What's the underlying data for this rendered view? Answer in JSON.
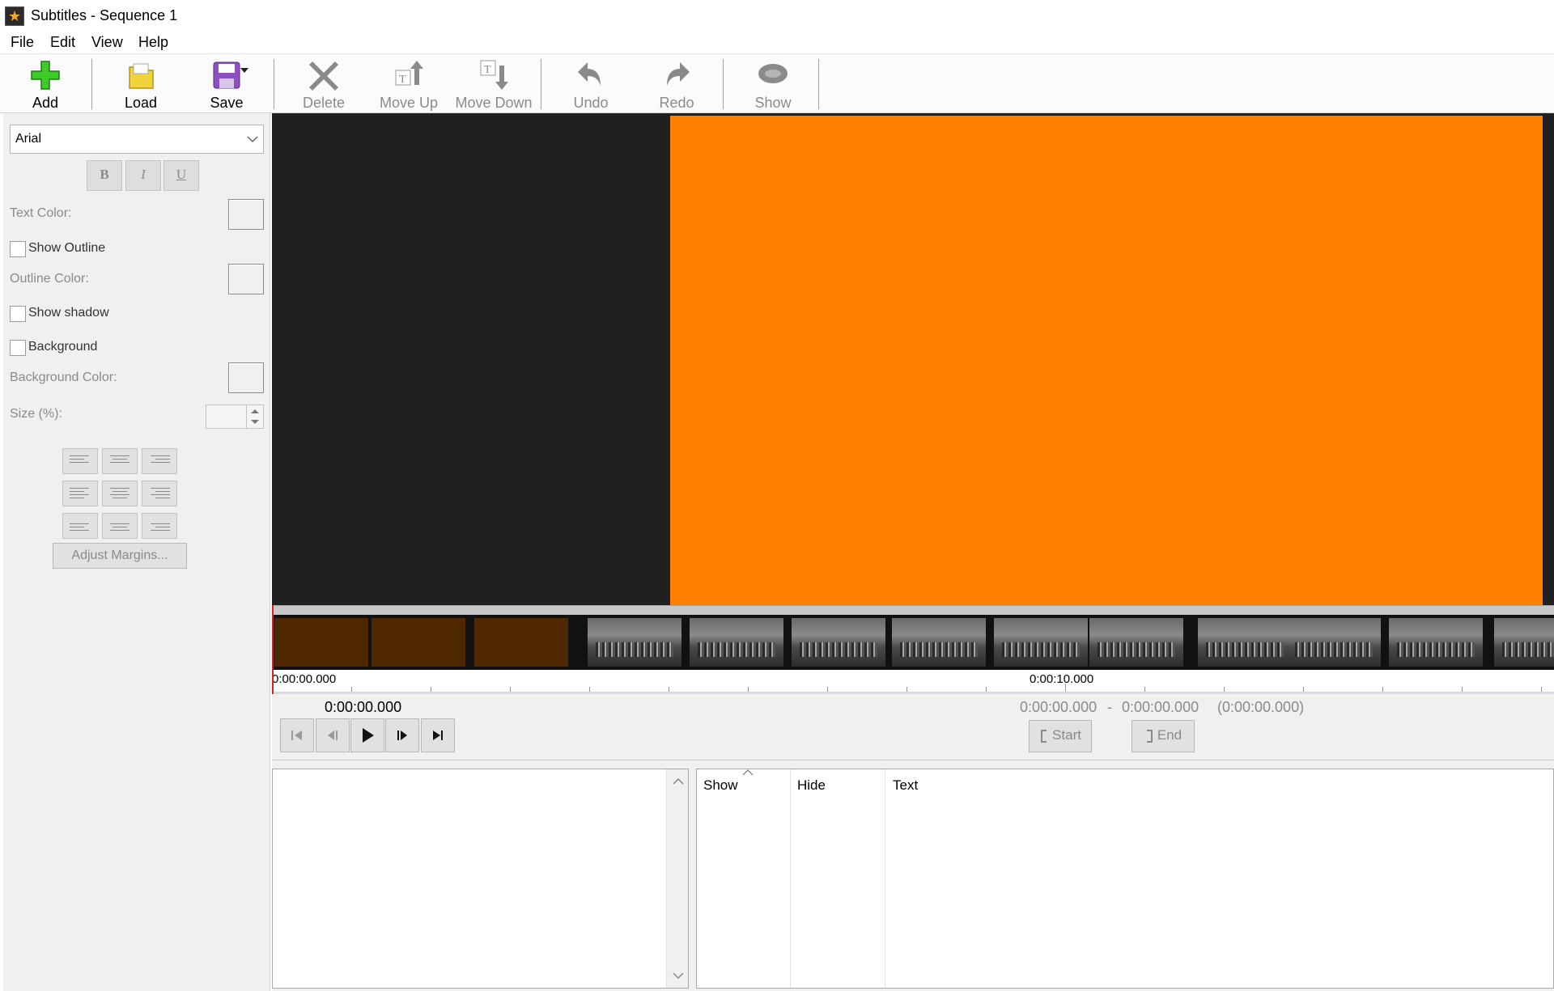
{
  "window": {
    "title": "Subtitles - Sequence 1",
    "icon": "clapperboard-star-icon"
  },
  "menu": [
    "File",
    "Edit",
    "View",
    "Help"
  ],
  "toolbar": {
    "add": "Add",
    "load": "Load",
    "save": "Save",
    "delete": "Delete",
    "move_up": "Move Up",
    "move_down": "Move Down",
    "undo": "Undo",
    "redo": "Redo",
    "show": "Show"
  },
  "style_panel": {
    "font": "Arial",
    "bold": "B",
    "italic": "I",
    "underline": "U",
    "text_color_label": "Text Color:",
    "show_outline": "Show Outline",
    "outline_color_label": "Outline Color:",
    "show_shadow": "Show shadow",
    "background": "Background",
    "background_color_label": "Background Color:",
    "size_label": "Size (%):",
    "size_value": "",
    "adjust_margins": "Adjust Margins..."
  },
  "preview": {
    "colors": {
      "background": "#202020",
      "frame": "#ff8000"
    }
  },
  "timeline": {
    "start_label": "0:00:00.000",
    "mid_label": "0:00:10.000"
  },
  "transport": {
    "current_time": "0:00:00.000",
    "range_start": "0:00:00.000",
    "range_sep": "-",
    "range_end": "0:00:00.000",
    "duration": "(0:00:00.000)",
    "start_button": "Start",
    "end_button": "End"
  },
  "subtitle_list": {
    "columns": [
      "Show",
      "Hide",
      "Text"
    ],
    "rows": []
  }
}
